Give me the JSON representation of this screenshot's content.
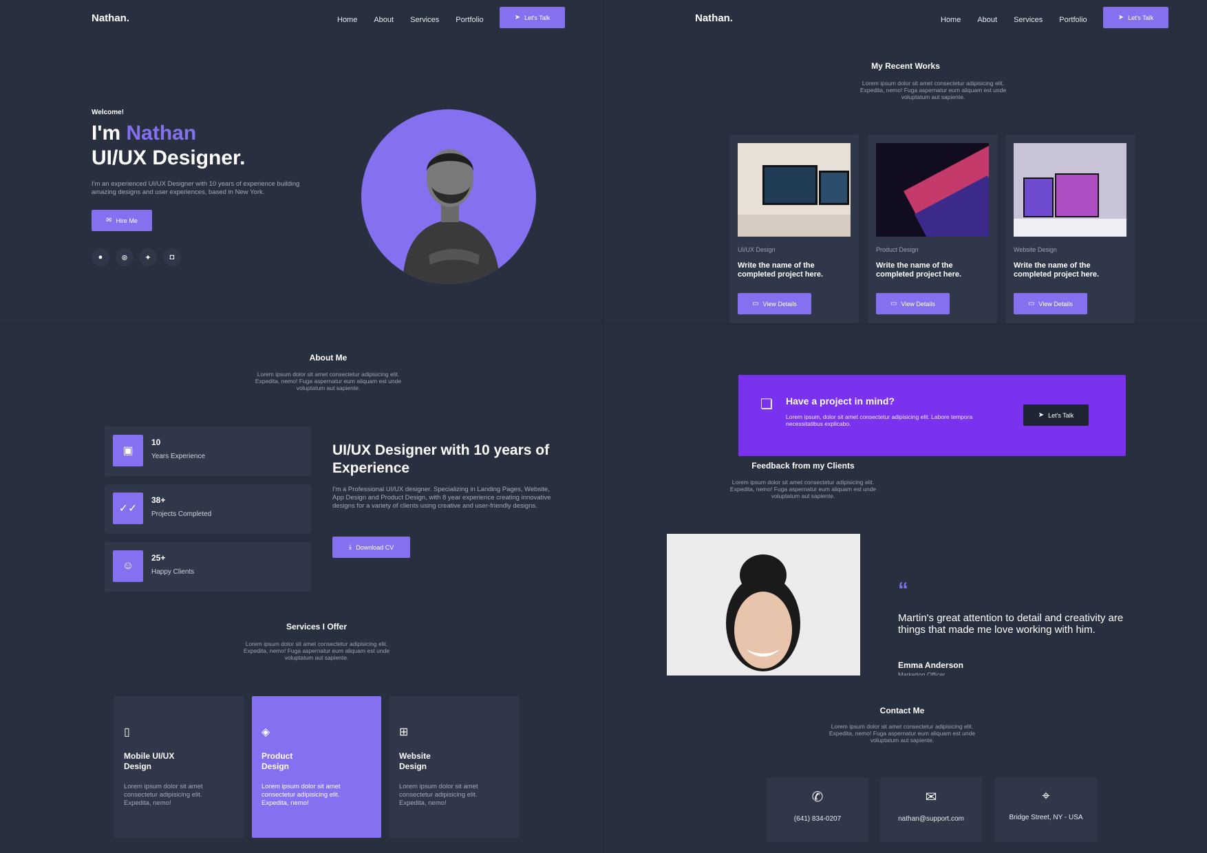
{
  "colors": {
    "accent": "#8570f0",
    "background": "#283040",
    "card": "#2f3748",
    "cta": "#7a32ee"
  },
  "nav": {
    "brand": "Nathan.",
    "links": [
      "Home",
      "About",
      "Services",
      "Portfolio"
    ],
    "cta": "Let's Talk"
  },
  "hero": {
    "welcome": "Welcome!",
    "im": "I'm ",
    "name": "Nathan",
    "role": "UI/UX Designer.",
    "desc": "I'm an experienced UI/UX Designer with 10 years of experience building amazing designs and user experiences, based in New York.",
    "hire": "Hire Me",
    "socials": [
      "github-icon",
      "dribbble-icon",
      "twitter-icon",
      "instagram-icon"
    ]
  },
  "works": {
    "title": "My Recent Works",
    "desc": "Lorem ipsum dolor sit amet consectetur adipisicing elit. Expedita, nemo! Fuga aspernatur eum aliquam est unde voluptatum aut sapiente.",
    "items": [
      {
        "category": "UI/UX Design",
        "name": "Write the name of the completed project here.",
        "button": "View Details"
      },
      {
        "category": "Product Design",
        "name": "Write the name of the completed project here.",
        "button": "View Details"
      },
      {
        "category": "Website Design",
        "name": "Write the name of the completed project here.",
        "button": "View Details"
      }
    ]
  },
  "about": {
    "title": "About Me",
    "desc": "Lorem ipsum dolor sit amet consectetur adipisicing elit. Expedita, nemo! Fuga aspernatur eum aliquam est unde voluptatum aut sapiente.",
    "stats": [
      {
        "num": "10",
        "label": "Years Experience",
        "icon": "briefcase-icon"
      },
      {
        "num": "38+",
        "label": "Projects Completed",
        "icon": "double-check-icon"
      },
      {
        "num": "25+",
        "label": "Happy Clients",
        "icon": "smile-icon"
      }
    ],
    "heading": "UI/UX Designer with 10 years of Experience",
    "body": "I'm a Professional UI/UX designer. Specializing in Landing Pages, Website, App Design and Product Design, with 8 year experience creating innovative designs for a variety of clients using creative and user-friendly designs.",
    "cv": "Download CV"
  },
  "services": {
    "title": "Services I Offer",
    "desc": "Lorem ipsum dolor sit amet consectetur adipisicing elit. Expedita, nemo! Fuga aspernatur eum aliquam est unde voluptatum aut sapiente.",
    "items": [
      {
        "title": "Mobile UI/UX\nDesign",
        "desc": "Lorem ipsum dolor sit amet consectetur adipisicing elit. Expedita, nemo!",
        "icon": "mobile-icon"
      },
      {
        "title": "Product\nDesign",
        "desc": "Lorem ipsum dolor sit amet consectetur adipisicing elit. Expedita, nemo!",
        "icon": "layers-icon"
      },
      {
        "title": "Website\nDesign",
        "desc": "Lorem ipsum dolor sit amet consectetur adipisicing elit. Expedita, nemo!",
        "icon": "layout-icon"
      }
    ]
  },
  "cta": {
    "title": "Have a project in mind?",
    "desc": "Lorem ipsum, dolor sit amet consectetur adipisicing elit. Labore tempora necessitatibus explicabo.",
    "button": "Let's Talk"
  },
  "feedback": {
    "title": "Feedback from my Clients",
    "desc": "Lorem ipsum dolor sit amet consectetur adipisicing elit. Expedita, nemo! Fuga aspernatur eum aliquam est unde voluptatum aut sapiente.",
    "quote": "Martin's great attention to detail and creativity are things that made me love working with him.",
    "author": "Emma Anderson",
    "role": "Marketing Officer"
  },
  "contact": {
    "title": "Contact Me",
    "desc": "Lorem ipsum dolor sit amet consectetur adipisicing elit. Expedita, nemo! Fuga aspernatur eum aliquam est unde voluptatum aut sapiente.",
    "items": [
      {
        "value": "(641) 834-0207",
        "icon": "phone-icon"
      },
      {
        "value": "nathan@support.com",
        "icon": "mail-icon"
      },
      {
        "value": "Bridge Street, NY - USA",
        "icon": "location-icon"
      }
    ]
  }
}
